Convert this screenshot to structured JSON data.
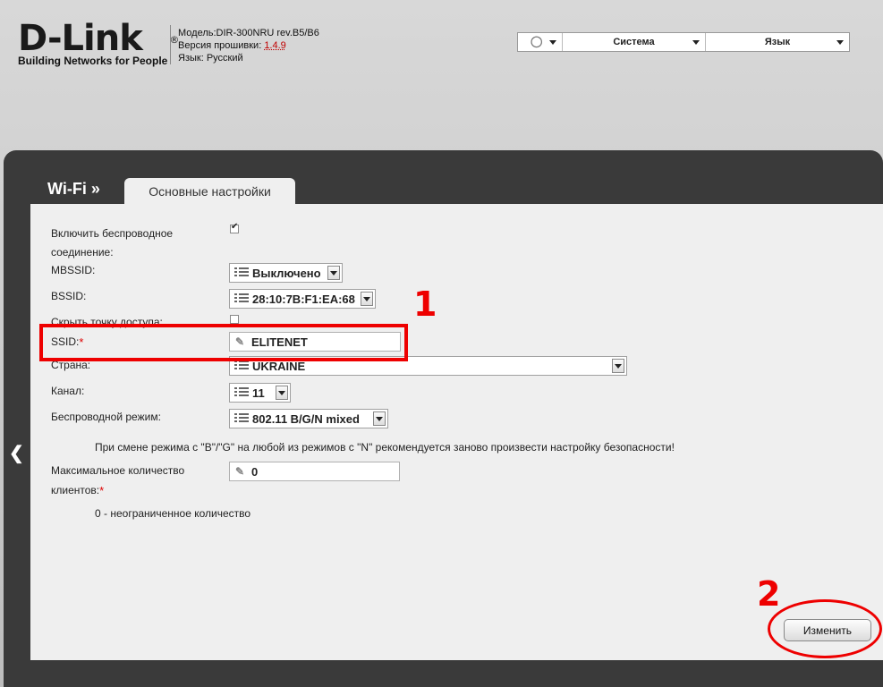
{
  "header": {
    "logo_text": "D-Link",
    "logo_reg": "®",
    "logo_tagline": "Building Networks for People",
    "model_line": "Модель:DIR-300NRU rev.B5/B6",
    "firmware_label": "Версия прошивки: ",
    "firmware_value": "1.4.9",
    "language_line": "Язык: Русский"
  },
  "topmenu": {
    "items": [
      {
        "label": "",
        "icon": "lightbulb-icon"
      },
      {
        "label": "Система"
      },
      {
        "label": "Язык"
      }
    ]
  },
  "nav": {
    "breadcrumb": "Wi-Fi »",
    "tab": "Основные настройки"
  },
  "form": {
    "enable_wireless_label": "Включить беспроводное соединение:",
    "enable_wireless_checked": true,
    "mbssid_label": "MBSSID:",
    "mbssid_value": "Выключено",
    "bssid_label": "BSSID:",
    "bssid_value": "28:10:7B:F1:EA:68",
    "hide_ap_label": "Скрыть точку доступа:",
    "hide_ap_checked": false,
    "ssid_label": "SSID:",
    "ssid_value": "ELITENET",
    "country_label": "Страна:",
    "country_value": "UKRAINE",
    "channel_label": "Канал:",
    "channel_value": "11",
    "mode_label": "Беспроводной режим:",
    "mode_value": "802.11 B/G/N mixed",
    "mode_hint": "При смене режима с \"B\"/\"G\" на любой из режимов с \"N\" рекомендуется заново произвести настройку безопасности!",
    "max_clients_label_1": "Максимальное количество",
    "max_clients_label_2": "клиентов:",
    "max_clients_value": "0",
    "max_clients_hint": "0 - неограниченное количество",
    "required_mark": "*"
  },
  "actions": {
    "apply_label": "Изменить"
  },
  "annotations": {
    "marker_1": "1",
    "marker_2": "2",
    "highlight_color": "#ee0000"
  }
}
